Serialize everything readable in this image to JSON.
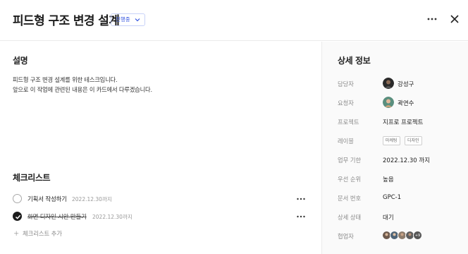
{
  "header": {
    "title": "피드형 구조 변경 설계",
    "status": "진행중",
    "more_icon": "more-horizontal-icon",
    "close_icon": "close-icon"
  },
  "description": {
    "heading": "설명",
    "lines": [
      "피드형 구조 변경 설계를 위한 테스크입니다.",
      "앞으로 이 작업에 관련된 내용은 이 카드에서 다루겠습니다."
    ]
  },
  "checklist": {
    "heading": "체크리스트",
    "items": [
      {
        "text": "기획서 작성하기",
        "date": "2022.12.30까지",
        "done": false
      },
      {
        "text": "화면 디자인 시안 만들기",
        "date": "2022.12.30까지",
        "done": true
      }
    ],
    "add_label": "체크리스트 추가"
  },
  "details": {
    "heading": "상세 정보",
    "assignee": {
      "label": "담당자",
      "value": "강성구"
    },
    "requester": {
      "label": "요청자",
      "value": "곽연수"
    },
    "project": {
      "label": "프로젝트",
      "value": "지프로 프로젝트"
    },
    "labels": {
      "label": "레이블",
      "tags": [
        "마케팅",
        "디자인"
      ]
    },
    "due": {
      "label": "업무 기한",
      "value": "2022.12.30 까지"
    },
    "priority": {
      "label": "우선 순위",
      "value": "높음"
    },
    "doc_no": {
      "label": "문서 번호",
      "value": "GPC-1"
    },
    "state": {
      "label": "상세 상태",
      "value": "대기"
    },
    "collaborators": {
      "label": "협업자",
      "more": "+9"
    }
  },
  "colors": {
    "status_accent": "#3556e0",
    "checked": "#1c1c1c"
  }
}
